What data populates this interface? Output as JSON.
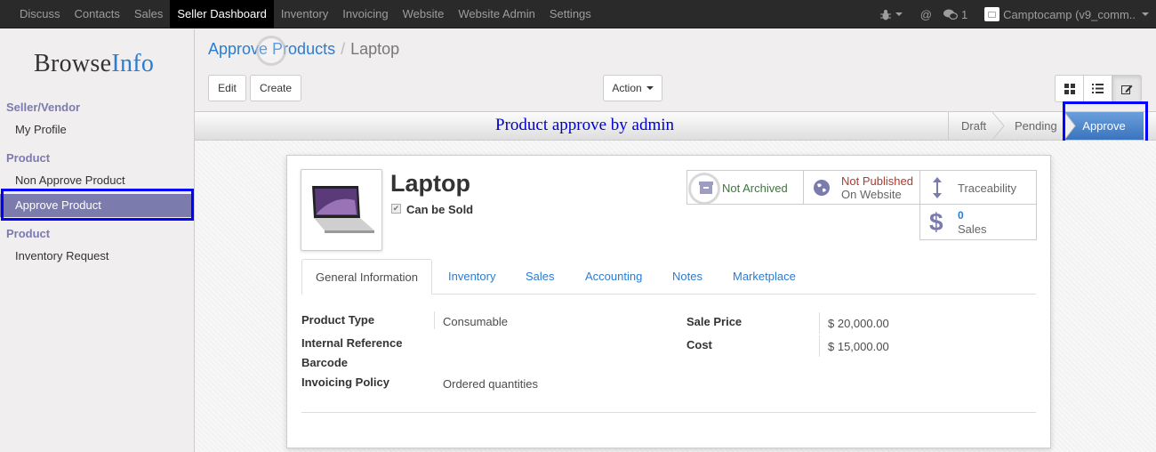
{
  "topbar": {
    "menu": [
      "Discuss",
      "Contacts",
      "Sales",
      "Seller Dashboard",
      "Inventory",
      "Invoicing",
      "Website",
      "Website Admin",
      "Settings"
    ],
    "active_menu": "Seller Dashboard",
    "chat_count": "1",
    "company": "Camptocamp (v9_comm.."
  },
  "sidebar": {
    "logo_browse": "Browse",
    "logo_info": "Info",
    "sections": [
      {
        "heading": "Seller/Vendor",
        "items": [
          "My Profile"
        ]
      },
      {
        "heading": "Product",
        "items": [
          "Non Approve Product",
          "Approve Product"
        ]
      },
      {
        "heading": "Product",
        "items": [
          "Inventory Request"
        ]
      }
    ],
    "active_item": "Approve Product"
  },
  "breadcrumb": {
    "parent": "Approve Products",
    "separator": "/",
    "current": "Laptop"
  },
  "buttons": {
    "edit": "Edit",
    "create": "Create",
    "action": "Action"
  },
  "statusbar": {
    "title": "Product approve by admin",
    "stages": [
      "Draft",
      "Pending",
      "Approve"
    ],
    "current_stage": "Approve"
  },
  "product": {
    "name": "Laptop",
    "can_be_sold_label": "Can be Sold",
    "can_be_sold": true
  },
  "smart_buttons": {
    "archived": "Not Archived",
    "published_line1": "Not Published",
    "published_line2": "On Website",
    "traceability": "Traceability",
    "sales_count": "0",
    "sales_label": "Sales"
  },
  "tabs": [
    "General Information",
    "Inventory",
    "Sales",
    "Accounting",
    "Notes",
    "Marketplace"
  ],
  "active_tab": "General Information",
  "fields": {
    "product_type_label": "Product Type",
    "product_type": "Consumable",
    "internal_ref_label": "Internal Reference",
    "barcode_label": "Barcode",
    "invoicing_policy_label": "Invoicing Policy",
    "invoicing_policy": "Ordered quantities",
    "sale_price_label": "Sale Price",
    "sale_price": "$ 20,000.00",
    "cost_label": "Cost",
    "cost": "$ 15,000.00"
  },
  "colors": {
    "topbar": "#2a2a2a",
    "accent_purple": "#7c7bad",
    "link_blue": "#2b7cd3",
    "annotation_blue": "#0000ff",
    "not_published_red": "#b03a2e",
    "not_archived_green": "#3c763d"
  }
}
